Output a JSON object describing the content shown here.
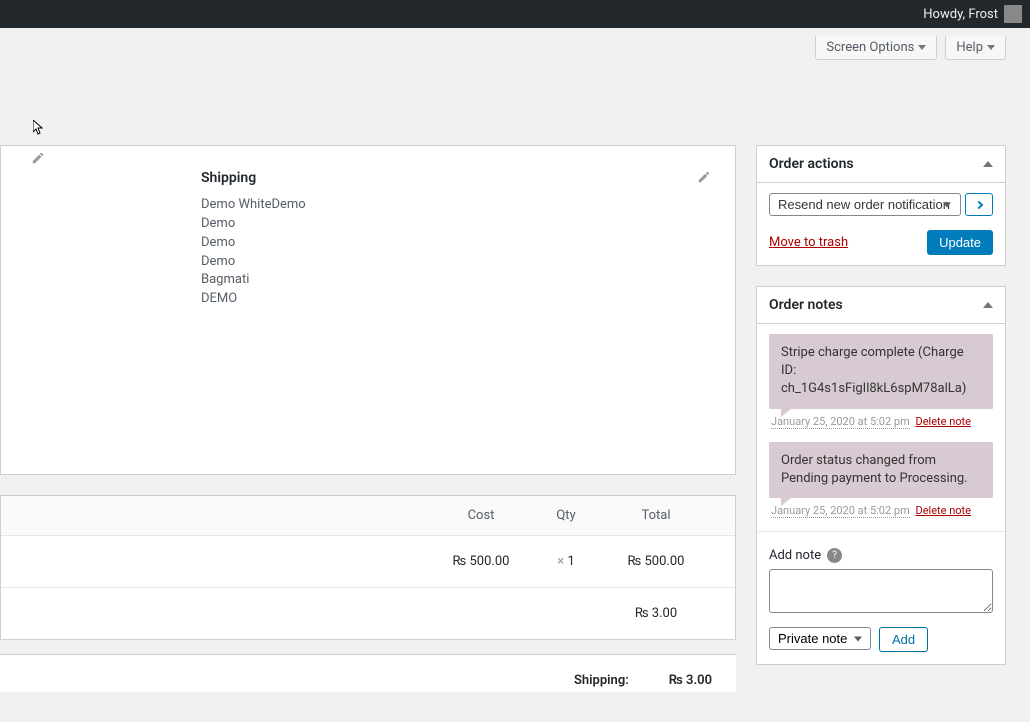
{
  "admin_bar": {
    "greeting": "Howdy, Frost"
  },
  "top_options": {
    "screen_options": "Screen Options",
    "help": "Help"
  },
  "shipping": {
    "heading": "Shipping",
    "lines": [
      "Demo WhiteDemo",
      "Demo",
      "Demo",
      "Demo",
      "Bagmati",
      "DEMO"
    ]
  },
  "items_table": {
    "headers": {
      "cost": "Cost",
      "qty": "Qty",
      "total": "Total"
    },
    "row": {
      "cost": "₨ 500.00",
      "qty_prefix": "×",
      "qty": "1",
      "total": "₨ 500.00"
    },
    "shipping_row": {
      "total": "₨ 3.00"
    },
    "footer": {
      "label": "Shipping:",
      "value": "₨ 3.00"
    }
  },
  "order_actions": {
    "title": "Order actions",
    "select_value": "Resend new order notification",
    "trash": "Move to trash",
    "update": "Update"
  },
  "order_notes": {
    "title": "Order notes",
    "notes": [
      {
        "text": "Stripe charge complete (Charge ID: ch_1G4s1sFigIl8kL6spM78alLa)",
        "timestamp": "January 25, 2020 at 5:02 pm",
        "delete": "Delete note"
      },
      {
        "text": "Order status changed from Pending payment to Processing.",
        "timestamp": "January 25, 2020 at 5:02 pm",
        "delete": "Delete note"
      }
    ],
    "add_label": "Add note",
    "note_type": "Private note",
    "add_button": "Add"
  }
}
